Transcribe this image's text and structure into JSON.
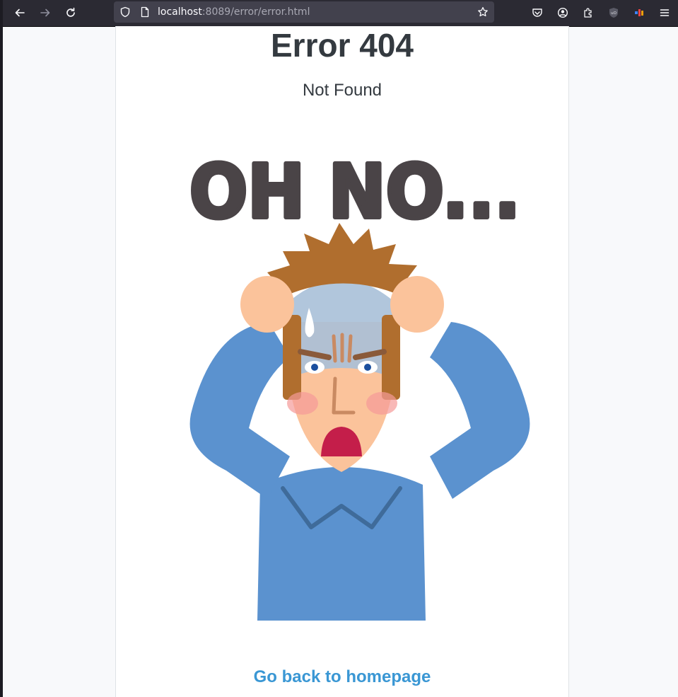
{
  "browser": {
    "url_host": "localhost",
    "url_rest": ":8089/error/error.html"
  },
  "error": {
    "title": "Error 404",
    "subtitle": "Not Found",
    "illustration_text": "OH NO...",
    "link_label": "Go back to homepage"
  },
  "colors": {
    "title": "#343a40",
    "link": "#3a97d4",
    "toolbar": "#2b2a33",
    "urlbar": "#42414d"
  }
}
